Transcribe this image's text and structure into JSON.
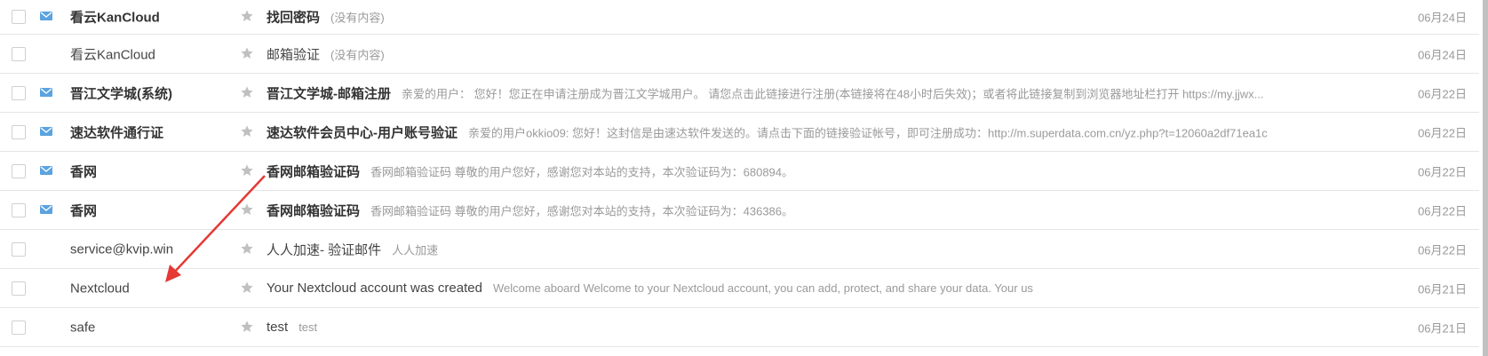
{
  "colors": {
    "unread_icon": "#5ba3e0",
    "star": "#c0c0c0",
    "arrow": "#e53935",
    "divider": "#e5e5e5"
  },
  "icons": {
    "unread": "envelope-icon",
    "star": "star-icon",
    "checkbox": "checkbox-icon",
    "arrow": "arrow-annotation"
  },
  "mails": [
    {
      "sender": "看云KanCloud",
      "subject": "找回密码",
      "preview": "(没有内容)",
      "date": "06月24日",
      "unread": true
    },
    {
      "sender": "看云KanCloud",
      "subject": "邮箱验证",
      "preview": "(没有内容)",
      "date": "06月24日",
      "unread": false
    },
    {
      "sender": "晋江文学城(系统)",
      "subject": "晋江文学城-邮箱注册",
      "preview": "亲爱的用户： 您好！您正在申请注册成为晋江文学城用户。 请您点击此链接进行注册(本链接将在48小时后失效)；或者将此链接复制到浏览器地址栏打开 https://my.jjwx...",
      "date": "06月22日",
      "unread": true
    },
    {
      "sender": "速达软件通行证",
      "subject": "速达软件会员中心-用户账号验证",
      "preview": "亲爱的用户okkio09: 您好！这封信是由速达软件发送的。请点击下面的链接验证帐号，即可注册成功：http://m.superdata.com.cn/yz.php?t=12060a2df71ea1c",
      "date": "06月22日",
      "unread": true
    },
    {
      "sender": "香网",
      "subject": "香网邮箱验证码",
      "preview": "香网邮箱验证码 尊敬的用户您好，感谢您对本站的支持，本次验证码为：680894。",
      "date": "06月22日",
      "unread": true
    },
    {
      "sender": "香网",
      "subject": "香网邮箱验证码",
      "preview": "香网邮箱验证码 尊敬的用户您好，感谢您对本站的支持，本次验证码为：436386。",
      "date": "06月22日",
      "unread": true
    },
    {
      "sender": "service@kvip.win",
      "subject": "人人加速- 验证邮件",
      "preview": "人人加速",
      "date": "06月22日",
      "unread": false
    },
    {
      "sender": "Nextcloud",
      "subject": "Your Nextcloud account was created",
      "preview": "Welcome aboard Welcome to your Nextcloud account, you can add, protect, and share your data. Your us",
      "date": "06月21日",
      "unread": false
    },
    {
      "sender": "safe",
      "subject": "test",
      "preview": "test",
      "date": "06月21日",
      "unread": false
    }
  ]
}
